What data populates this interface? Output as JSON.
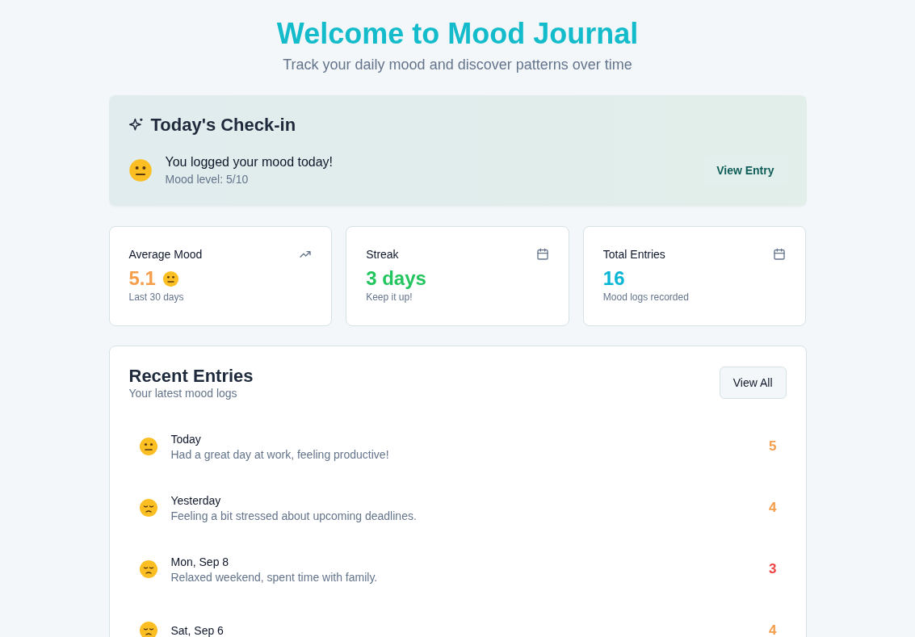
{
  "header": {
    "title": "Welcome to Mood Journal",
    "subtitle": "Track your daily mood and discover patterns over time"
  },
  "checkin": {
    "title": "Today's Check-in",
    "kind": "neutral",
    "message": "You logged your mood today!",
    "level_text": "Mood level: 5/10",
    "button": "View Entry"
  },
  "stats": [
    {
      "kind": "average",
      "label": "Average Mood",
      "value": "5.1",
      "color": "#f59e4b",
      "caption": "Last 30 days"
    },
    {
      "kind": "streak",
      "label": "Streak",
      "value": "3 days",
      "color": "#22c55e",
      "caption": "Keep it up!"
    },
    {
      "kind": "total",
      "label": "Total Entries",
      "value": "16",
      "color": "#06b6d4",
      "caption": "Mood logs recorded"
    }
  ],
  "recent": {
    "title": "Recent Entries",
    "subtitle": "Your latest mood logs",
    "button": "View All",
    "entries": [
      {
        "kind": "neutral",
        "date": "Today",
        "note": "Had a great day at work, feeling productive!",
        "score": "5",
        "color": "#f59e4b"
      },
      {
        "kind": "sad",
        "date": "Yesterday",
        "note": "Feeling a bit stressed about upcoming deadlines.",
        "score": "4",
        "color": "#f59e4b"
      },
      {
        "kind": "sad",
        "date": "Mon, Sep 8",
        "note": "Relaxed weekend, spent time with family.",
        "score": "3",
        "color": "#ef4444"
      },
      {
        "kind": "sad",
        "date": "Sat, Sep 6",
        "score": "4",
        "color": "#f59e4b"
      }
    ]
  }
}
